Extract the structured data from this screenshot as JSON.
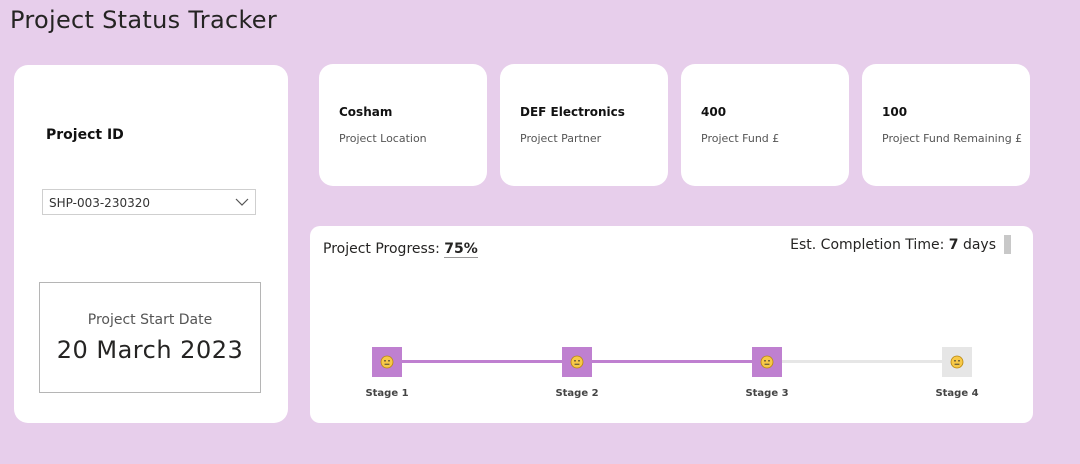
{
  "page": {
    "title": "Project Status Tracker"
  },
  "project": {
    "id_label": "Project ID",
    "id_value": "SHP-003-230320",
    "start_label": "Project Start Date",
    "start_value": "20 March 2023"
  },
  "kpis": [
    {
      "value": "Cosham",
      "label": "Project Location"
    },
    {
      "value": "DEF Electronics",
      "label": "Project Partner"
    },
    {
      "value": "400",
      "label": "Project Fund £"
    },
    {
      "value": "100",
      "label": "Project Fund Remaining £"
    }
  ],
  "progress": {
    "label": "Project Progress:",
    "value": "75%",
    "fraction": 0.75,
    "completion_label": "Est. Completion Time:",
    "completion_value": "7",
    "completion_unit": "days"
  },
  "stages": [
    {
      "label": "Stage 1",
      "done": true,
      "icon": "smiley-icon"
    },
    {
      "label": "Stage 2",
      "done": true,
      "icon": "smiley-icon"
    },
    {
      "label": "Stage 3",
      "done": true,
      "icon": "smiley-icon"
    },
    {
      "label": "Stage 4",
      "done": false,
      "icon": "smiley-icon"
    }
  ],
  "colors": {
    "background": "#e7ceeb",
    "accent": "#bf80d0",
    "pending": "#e6e6e6"
  }
}
